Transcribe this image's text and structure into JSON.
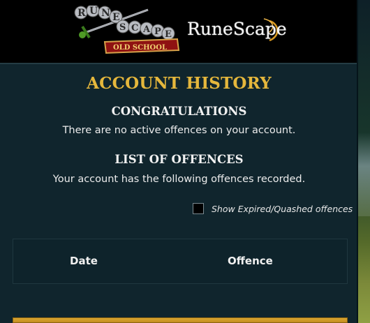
{
  "header": {
    "logo_os": {
      "rune": "RUNE",
      "scape": "SCAPE",
      "banner": "OLD SCHOOL"
    },
    "logo_rs": "RuneScape"
  },
  "page": {
    "title": "ACCOUNT HISTORY"
  },
  "congratulations": {
    "heading": "CONGRATULATIONS",
    "text": "There are no active offences on your account."
  },
  "offences": {
    "heading": "LIST OF OFFENCES",
    "text": "Your account has the following offences recorded.",
    "toggle_label": "Show Expired/Quashed offences",
    "toggle_checked": false,
    "columns": [
      "Date",
      "Offence"
    ]
  },
  "colors": {
    "accent_gold": "#e5b73c",
    "panel_bg": "#10252d"
  }
}
